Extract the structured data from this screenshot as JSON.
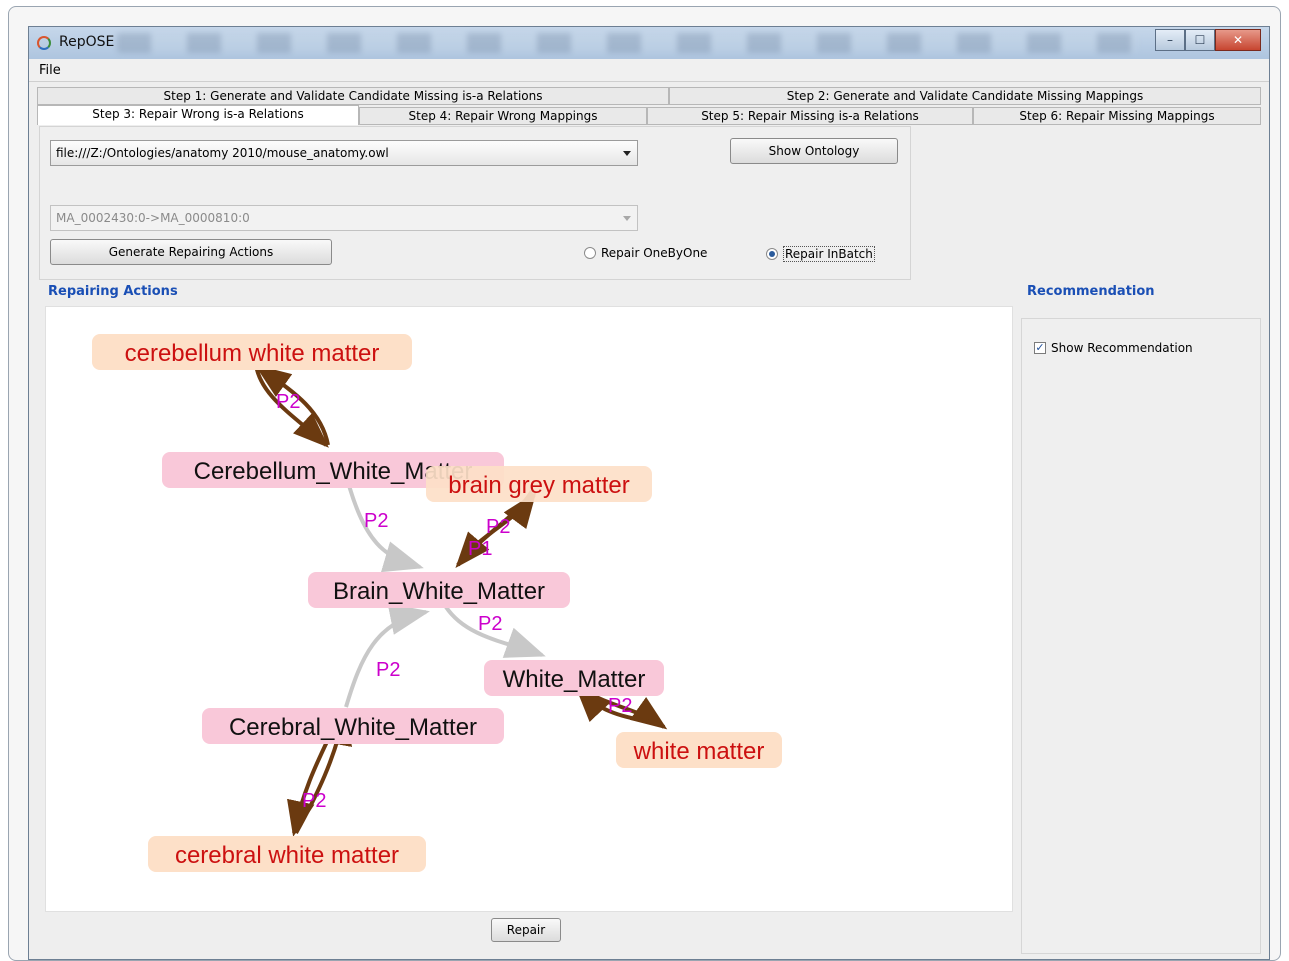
{
  "window": {
    "title": "RepOSE",
    "controls": {
      "minimize": "–",
      "maximize": "☐",
      "close": "✕"
    }
  },
  "menu": {
    "file": "File"
  },
  "tabs": {
    "row1": [
      "Step 1: Generate and Validate Candidate Missing is-a Relations",
      "Step 2: Generate and Validate Candidate Missing Mappings"
    ],
    "row2": [
      "Step 3: Repair Wrong is-a Relations",
      "Step 4: Repair Wrong Mappings",
      "Step 5: Repair Missing is-a Relations",
      "Step 6: Repair Missing Mappings"
    ],
    "active": "Step 3: Repair Wrong is-a Relations"
  },
  "controls": {
    "ontology_select": "file:///Z:/Ontologies/anatomy 2010/mouse_anatomy.owl",
    "relation_select": "MA_0002430:0->MA_0000810:0",
    "show_ontology_label": "Show Ontology",
    "generate_label": "Generate Repairing Actions",
    "radio_one_by_one": "Repair OneByOne",
    "radio_in_batch": "Repair InBatch",
    "repair_mode_selected": "Repair InBatch"
  },
  "sections": {
    "repairing_actions": "Repairing Actions",
    "recommendation": "Recommendation"
  },
  "recommendation": {
    "show_label": "Show Recommendation",
    "checked": true
  },
  "repair_button_label": "Repair",
  "graph": {
    "nodes": [
      {
        "id": "n1",
        "label": "cerebellum white matter",
        "kind": "mapping"
      },
      {
        "id": "n2",
        "label": "Cerebellum_White_Matter",
        "kind": "concept"
      },
      {
        "id": "n3",
        "label": "brain grey matter",
        "kind": "mapping"
      },
      {
        "id": "n4",
        "label": "Brain_White_Matter",
        "kind": "concept"
      },
      {
        "id": "n5",
        "label": "White_Matter",
        "kind": "concept"
      },
      {
        "id": "n6",
        "label": "white matter",
        "kind": "mapping"
      },
      {
        "id": "n7",
        "label": "Cerebral_White_Matter",
        "kind": "concept"
      },
      {
        "id": "n8",
        "label": "cerebral white matter",
        "kind": "mapping"
      }
    ],
    "edge_labels": [
      {
        "id": "e1",
        "label": "P2"
      },
      {
        "id": "e2",
        "label": "P2"
      },
      {
        "id": "e3",
        "label": "P2"
      },
      {
        "id": "e4",
        "label": "P1"
      },
      {
        "id": "e5",
        "label": "P2"
      },
      {
        "id": "e6",
        "label": "P2"
      },
      {
        "id": "e7",
        "label": "P2"
      },
      {
        "id": "e8",
        "label": "P2"
      }
    ],
    "colors": {
      "concept_bg": "#f9c8d9",
      "mapping_bg": "#fde0c8",
      "concept_text": "#111111",
      "mapping_text": "#cc1010",
      "edge_label": "#cc00cc",
      "edge_isa": "#c8c8c8",
      "edge_mapping": "#6b3a10"
    }
  }
}
